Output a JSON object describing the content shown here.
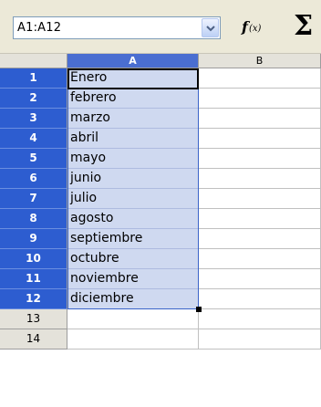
{
  "formula_bar": {
    "name_box_value": "A1:A12",
    "function_wizard_icon": "fx-icon",
    "sum_icon": "sigma-icon"
  },
  "columns": [
    {
      "label": "A",
      "selected": true
    },
    {
      "label": "B",
      "selected": false
    }
  ],
  "rows": [
    {
      "num": "1",
      "a": "Enero",
      "selected": true
    },
    {
      "num": "2",
      "a": "febrero",
      "selected": true
    },
    {
      "num": "3",
      "a": "marzo",
      "selected": true
    },
    {
      "num": "4",
      "a": "abril",
      "selected": true
    },
    {
      "num": "5",
      "a": "mayo",
      "selected": true
    },
    {
      "num": "6",
      "a": "junio",
      "selected": true
    },
    {
      "num": "7",
      "a": "julio",
      "selected": true
    },
    {
      "num": "8",
      "a": "agosto",
      "selected": true
    },
    {
      "num": "9",
      "a": "septiembre",
      "selected": true
    },
    {
      "num": "10",
      "a": "octubre",
      "selected": true
    },
    {
      "num": "11",
      "a": "noviembre",
      "selected": true
    },
    {
      "num": "12",
      "a": "diciembre",
      "selected": true
    },
    {
      "num": "13",
      "a": "",
      "selected": false
    },
    {
      "num": "14",
      "a": "",
      "selected": false
    }
  ],
  "colors": {
    "selected_header": "#2d5dd0",
    "selected_cells": "#cfd9f0",
    "header_bg": "#e4e2da"
  }
}
